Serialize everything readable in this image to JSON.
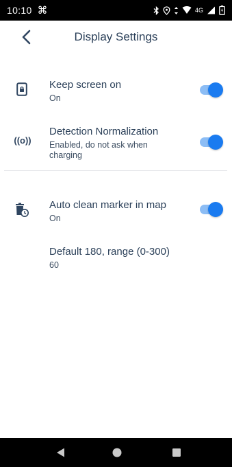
{
  "status_bar": {
    "time": "10:10",
    "app_icon": "⌘",
    "network_label": "4G",
    "icons": [
      "bluetooth-icon",
      "location-icon",
      "data-arrows-icon",
      "wifi-icon",
      "signal-icon",
      "battery-icon"
    ]
  },
  "header": {
    "title": "Display Settings",
    "back_icon": "chevron-left-icon"
  },
  "settings": [
    {
      "icon": "phone-lock-icon",
      "title": "Keep screen on",
      "subtitle": "On",
      "toggle_on": true
    },
    {
      "icon": "broadcast-icon",
      "icon_text": "((o))",
      "title": "Detection Normalization",
      "subtitle": "Enabled, do not ask when charging",
      "toggle_on": true
    },
    {
      "icon": "trash-clock-icon",
      "title": "Auto clean marker in map",
      "subtitle": "On",
      "toggle_on": true
    },
    {
      "title": "Default 180, range (0-300)",
      "subtitle": "60"
    }
  ],
  "nav_bar": {
    "buttons": [
      "back-triangle-icon",
      "home-circle-icon",
      "recents-square-icon"
    ]
  },
  "colors": {
    "accent": "#1a7bf0",
    "accent_track": "#8cbdf5",
    "text": "#2a3f58",
    "bar_background": "#000000"
  }
}
